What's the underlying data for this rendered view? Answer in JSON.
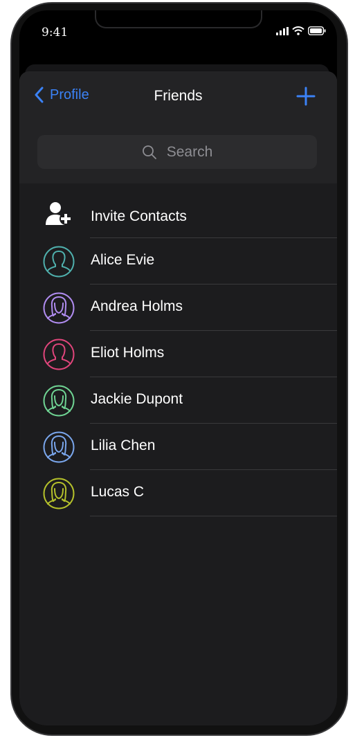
{
  "status_bar": {
    "time": "9:41"
  },
  "nav": {
    "back_label": "Profile",
    "title": "Friends",
    "accent_color": "#3b82f6"
  },
  "search": {
    "placeholder": "Search"
  },
  "invite": {
    "label": "Invite Contacts",
    "icon": "add-contact-icon"
  },
  "friends": [
    {
      "name": "Alice Evie",
      "avatar_color": "#4fb0ad",
      "avatar": "male-avatar-icon"
    },
    {
      "name": "Andrea Holms",
      "avatar_color": "#b08cf0",
      "avatar": "female-avatar-icon"
    },
    {
      "name": "Eliot Holms",
      "avatar_color": "#e0457b",
      "avatar": "male-avatar-icon"
    },
    {
      "name": "Jackie Dupont",
      "avatar_color": "#6fd393",
      "avatar": "female-avatar-icon"
    },
    {
      "name": "Lilia Chen",
      "avatar_color": "#7aa6ec",
      "avatar": "female-avatar-icon"
    },
    {
      "name": "Lucas C",
      "avatar_color": "#b5c12b",
      "avatar": "female-avatar-icon"
    }
  ]
}
